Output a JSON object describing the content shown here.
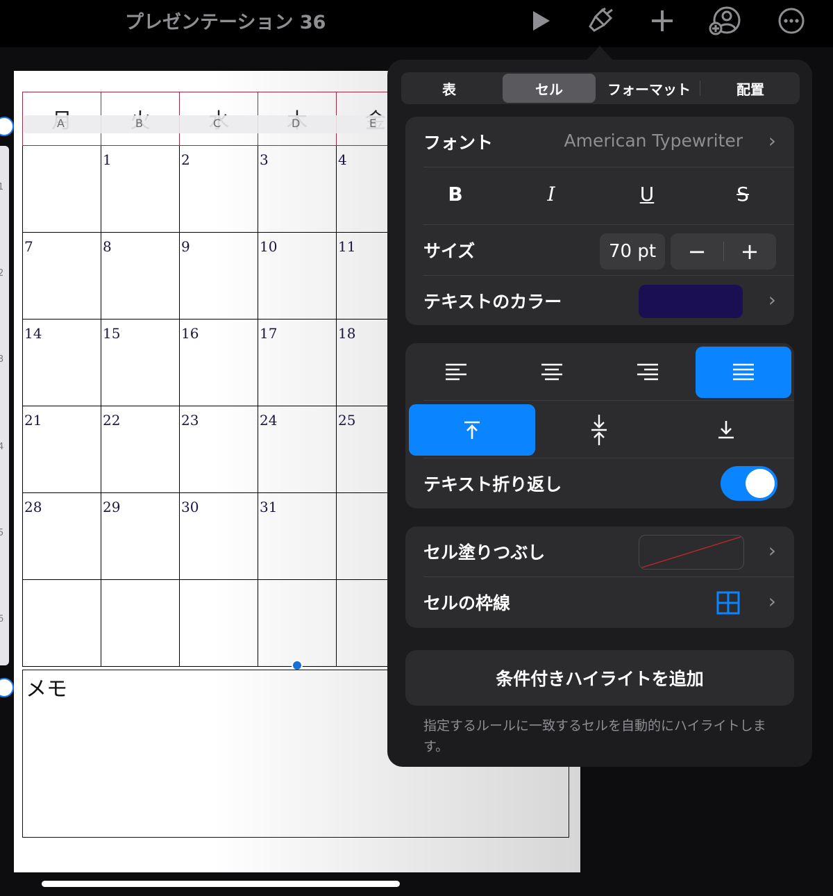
{
  "toolbar": {
    "title": "プレゼンテーション 36",
    "icons": [
      "play-icon",
      "paintbrush-icon",
      "plus-icon",
      "collaborate-icon",
      "more-icon"
    ]
  },
  "calendar": {
    "weekday_headers": [
      "月",
      "火",
      "水",
      "木",
      "金"
    ],
    "column_refs": [
      "A",
      "B",
      "C",
      "D",
      "E"
    ],
    "rows": [
      [
        "",
        "1",
        "2",
        "3",
        "4"
      ],
      [
        "7",
        "8",
        "9",
        "10",
        "11"
      ],
      [
        "14",
        "15",
        "16",
        "17",
        "18"
      ],
      [
        "21",
        "22",
        "23",
        "24",
        "25"
      ],
      [
        "28",
        "29",
        "30",
        "31",
        ""
      ],
      [
        "",
        "",
        "",
        "",
        ""
      ]
    ],
    "row_refs": [
      "1",
      "2",
      "3",
      "4",
      "5",
      "6"
    ],
    "memo_label": "メモ"
  },
  "format_panel": {
    "tabs": [
      "表",
      "セル",
      "フォーマット",
      "配置"
    ],
    "selected_tab": "セル",
    "font_label": "フォント",
    "font_value": "American Typewriter",
    "style_buttons": [
      "B",
      "I",
      "U",
      "S"
    ],
    "size_label": "サイズ",
    "size_value": "70 pt",
    "stepper_minus": "−",
    "stepper_plus": "+",
    "text_color_label": "テキストのカラー",
    "text_color": "#1a0f52",
    "horizontal_alignment": [
      "align-left",
      "align-center",
      "align-right",
      "align-justify"
    ],
    "selected_horizontal": "align-justify",
    "vertical_alignment": [
      "align-top",
      "align-middle",
      "align-bottom"
    ],
    "selected_vertical": "align-top",
    "wrap_label": "テキスト折り返し",
    "wrap_on": true,
    "cell_fill_label": "セル塗りつぶし",
    "cell_border_label": "セルの枠線",
    "conditional_highlight_button": "条件付きハイライトを追加",
    "conditional_highlight_note": "指定するルールに一致するセルを自動的にハイライトします。",
    "accent_color": "#0a84ff"
  }
}
